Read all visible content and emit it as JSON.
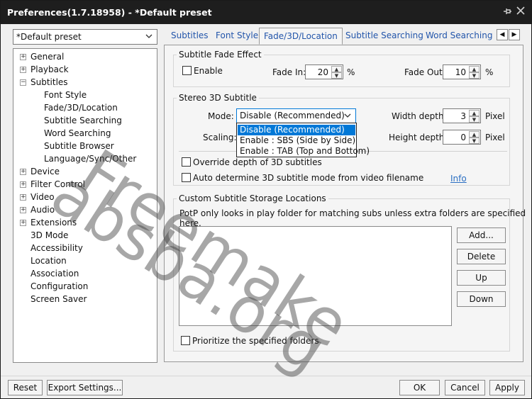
{
  "window": {
    "title": "Preferences(1.7.18958) - *Default preset",
    "pin_icon": "pin-icon",
    "close_icon": "close-icon"
  },
  "preset": {
    "value": "*Default preset"
  },
  "tree": [
    {
      "label": "General",
      "expander": "+",
      "level": 0
    },
    {
      "label": "Playback",
      "expander": "+",
      "level": 0
    },
    {
      "label": "Subtitles",
      "expander": "−",
      "level": 0
    },
    {
      "label": "Font Style",
      "expander": "",
      "level": 1
    },
    {
      "label": "Fade/3D/Location",
      "expander": "",
      "level": 1
    },
    {
      "label": "Subtitle Searching",
      "expander": "",
      "level": 1
    },
    {
      "label": "Word Searching",
      "expander": "",
      "level": 1
    },
    {
      "label": "Subtitle Browser",
      "expander": "",
      "level": 1
    },
    {
      "label": "Language/Sync/Other",
      "expander": "",
      "level": 1
    },
    {
      "label": "Device",
      "expander": "+",
      "level": 0
    },
    {
      "label": "Filter Control",
      "expander": "+",
      "level": 0
    },
    {
      "label": "Video",
      "expander": "+",
      "level": 0
    },
    {
      "label": "Audio",
      "expander": "+",
      "level": 0
    },
    {
      "label": "Extensions",
      "expander": "+",
      "level": 0
    },
    {
      "label": "3D Mode",
      "expander": "",
      "level": 0
    },
    {
      "label": "Accessibility",
      "expander": "",
      "level": 0
    },
    {
      "label": "Location",
      "expander": "",
      "level": 0
    },
    {
      "label": "Association",
      "expander": "",
      "level": 0
    },
    {
      "label": "Configuration",
      "expander": "",
      "level": 0
    },
    {
      "label": "Screen Saver",
      "expander": "",
      "level": 0
    }
  ],
  "tabs": [
    {
      "label": "Subtitles",
      "active": false
    },
    {
      "label": "Font Style",
      "active": false
    },
    {
      "label": "Fade/3D/Location",
      "active": true
    },
    {
      "label": "Subtitle Searching",
      "active": false
    },
    {
      "label": "Word Searching",
      "active": false
    }
  ],
  "tab_scroll": {
    "left": "◀",
    "right": "▶"
  },
  "fade": {
    "group_title": "Subtitle Fade Effect",
    "enable_label": "Enable",
    "fade_in_label": "Fade In:",
    "fade_in_value": "20",
    "fade_out_label": "Fade Out:",
    "fade_out_value": "10",
    "unit": "%"
  },
  "stereo": {
    "group_title": "Stereo 3D Subtitle",
    "mode_label": "Mode:",
    "mode_value": "Disable (Recommended)",
    "scaling_label": "Scaling:",
    "width_depth_label": "Width depth:",
    "width_depth_value": "3",
    "height_depth_label": "Height depth:",
    "height_depth_value": "0",
    "unit": "Pixel",
    "options": [
      "Disable (Recommended)",
      "Enable : SBS (Side by Side)",
      "Enable : TAB (Top and Bottom)"
    ],
    "override_label": "Override depth of 3D subtitles",
    "auto_label": "Auto determine 3D subtitle mode from video filename",
    "info_link": "Info"
  },
  "storage": {
    "group_title": "Custom Subtitle Storage Locations",
    "description": "PotP only looks in play folder for matching subs unless extra folders are specified here.",
    "add": "Add...",
    "delete": "Delete",
    "up": "Up",
    "down": "Down",
    "prioritize_label": "Prioritize the specified folders"
  },
  "footer": {
    "reset": "Reset",
    "export": "Export Settings...",
    "ok": "OK",
    "cancel": "Cancel",
    "apply": "Apply"
  },
  "watermark": {
    "line1": "Freemake",
    "line2": "absba.org"
  },
  "colors": {
    "titlebar": "#1e1e1e",
    "selection": "#0078d7",
    "link": "#2a6ec2",
    "tab_text": "#2255aa"
  }
}
